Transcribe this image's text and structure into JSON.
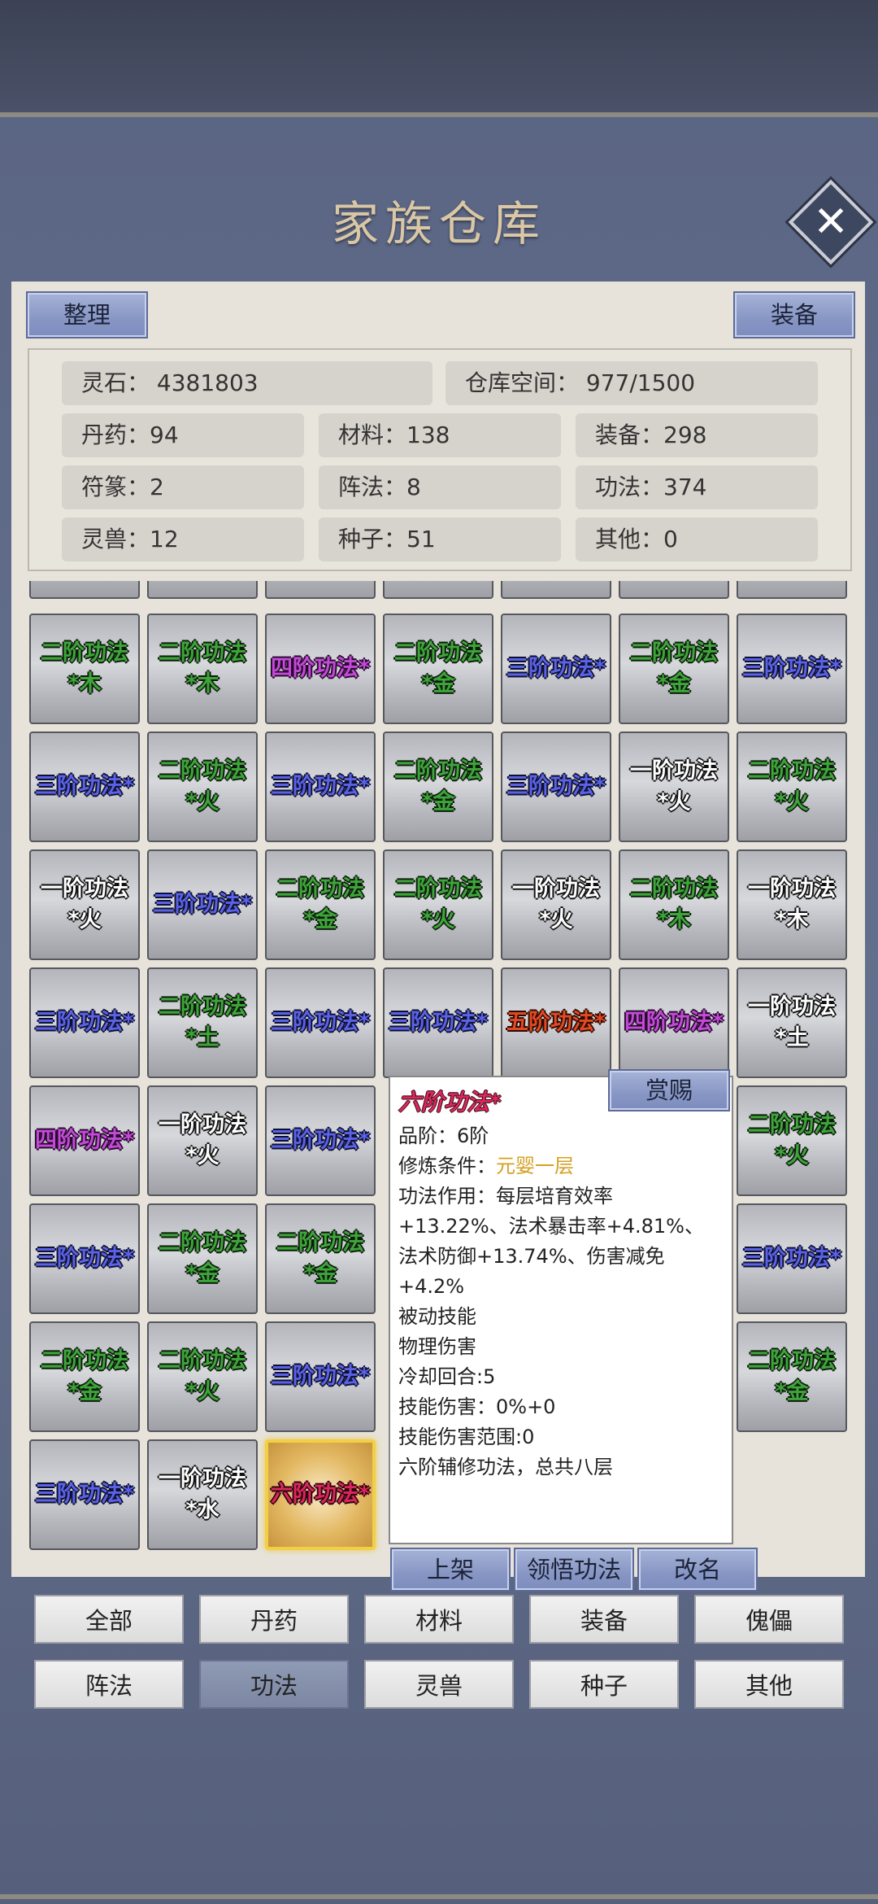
{
  "title": "家族仓库",
  "header": {
    "sort_label": "整理",
    "equip_label": "装备"
  },
  "stats": {
    "spirit_stone": "灵石：  4381803",
    "storage": "仓库空间：    977/1500",
    "items": [
      "丹药：94",
      "材料：138",
      "装备：298",
      "符篆：2",
      "阵法：8",
      "功法：374",
      "灵兽：12",
      "种子：51",
      "其他：0"
    ]
  },
  "grid": [
    [
      "二阶功法\n*木",
      "二阶功法\n*木",
      "四阶功法*",
      "二阶功法\n*金",
      "三阶功法*",
      "二阶功法\n*金",
      "三阶功法*"
    ],
    [
      "三阶功法*",
      "二阶功法\n*火",
      "三阶功法*",
      "二阶功法\n*金",
      "三阶功法*",
      "一阶功法\n*火",
      "二阶功法\n*火"
    ],
    [
      "一阶功法\n*火",
      "三阶功法*",
      "二阶功法\n*金",
      "二阶功法\n*火",
      "一阶功法\n*火",
      "二阶功法\n*木",
      "一阶功法\n*木"
    ],
    [
      "三阶功法*",
      "二阶功法\n*土",
      "三阶功法*",
      "三阶功法*",
      "五阶功法*",
      "四阶功法*",
      "一阶功法\n*土"
    ],
    [
      "四阶功法*",
      "一阶功法\n*火",
      "三阶功法*",
      "",
      "",
      "",
      "二阶功法\n*火"
    ],
    [
      "三阶功法*",
      "二阶功法\n*金",
      "二阶功法\n*金",
      "",
      "",
      "",
      "三阶功法*"
    ],
    [
      "二阶功法\n*金",
      "二阶功法\n*火",
      "三阶功法*",
      "",
      "",
      "",
      "二阶功法\n*金"
    ],
    [
      "三阶功法*",
      "一阶功法\n*水",
      "六阶功法*",
      "",
      "",
      "",
      ""
    ]
  ],
  "tooltip": {
    "reward_label": "赏赐",
    "name": "六阶功法*",
    "grade": "品阶：6阶",
    "condition_label": "修炼条件：",
    "condition_value": "元婴一层",
    "effect_1": "功法作用：每层培育效率",
    "effect_2": "+13.22%、法术暴击率+4.81%、",
    "effect_3": "法术防御+13.74%、伤害减免",
    "effect_4": "+4.2%",
    "passive": "被动技能",
    "damage_type": "物理伤害",
    "cooldown": "冷却回合:5",
    "skill_damage": "技能伤害：0%+0",
    "skill_range": "技能伤害范围:0",
    "description": "六阶辅修功法，总共八层"
  },
  "actions": [
    "上架",
    "领悟功法",
    "改名"
  ],
  "tabs": [
    "全部",
    "丹药",
    "材料",
    "装备",
    "傀儡",
    "阵法",
    "功法",
    "灵兽",
    "种子",
    "其他"
  ],
  "active_tab": "功法"
}
